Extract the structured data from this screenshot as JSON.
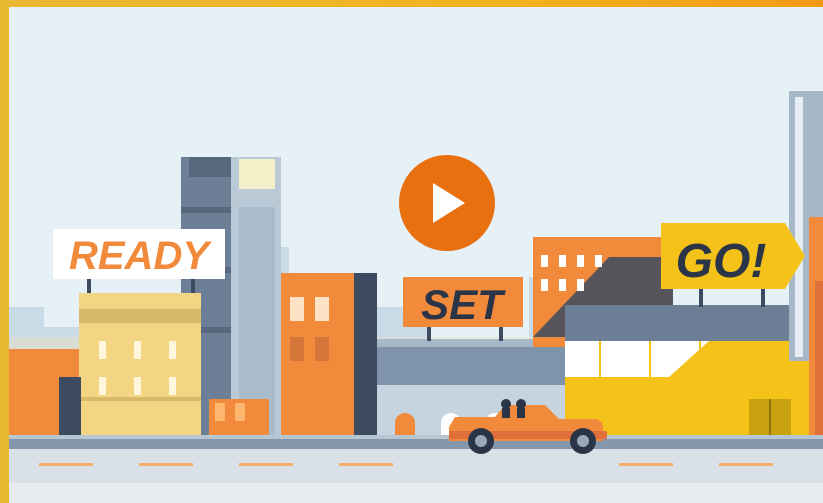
{
  "video": {
    "signs": {
      "ready": "READY",
      "set": "SET",
      "go": "GO!"
    },
    "play_icon": "play-icon",
    "colors": {
      "frame": "#f2b31f",
      "sky": "#e6f0f7",
      "play": "#e8700f",
      "sign_orange": "#f28a3c",
      "sign_yellow": "#f5c21a",
      "sign_text_dark": "#2b3548",
      "car": "#f28a3c"
    }
  }
}
